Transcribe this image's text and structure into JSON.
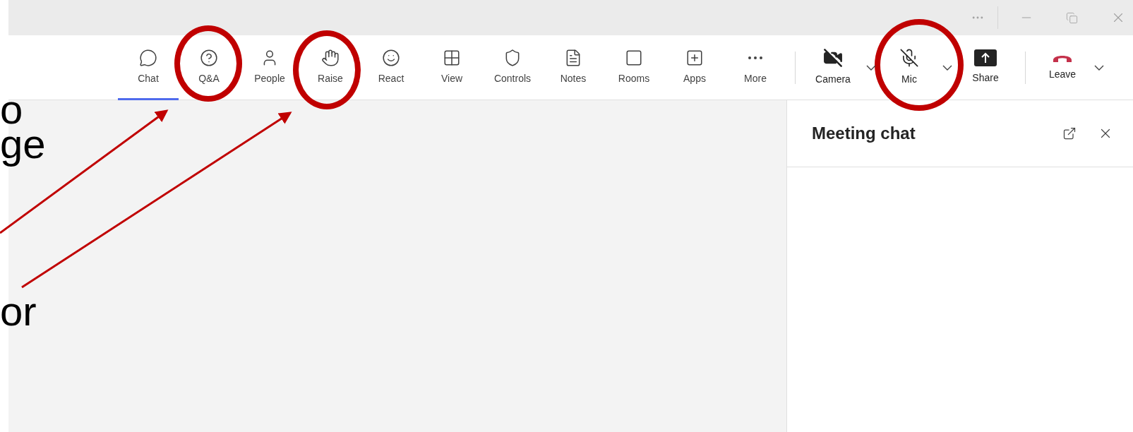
{
  "slide_text": [
    "o",
    "ge",
    "or"
  ],
  "toolbar": {
    "items": [
      {
        "kind": "chat",
        "label": "Chat",
        "selected": true,
        "circled": false
      },
      {
        "kind": "qa",
        "label": "Q&A",
        "selected": false,
        "circled": true
      },
      {
        "kind": "people",
        "label": "People",
        "selected": false,
        "circled": false
      },
      {
        "kind": "raise",
        "label": "Raise",
        "selected": false,
        "circled": true
      },
      {
        "kind": "react",
        "label": "React",
        "selected": false,
        "circled": false
      },
      {
        "kind": "view",
        "label": "View",
        "selected": false,
        "circled": false
      },
      {
        "kind": "controls",
        "label": "Controls",
        "selected": false,
        "circled": false
      },
      {
        "kind": "notes",
        "label": "Notes",
        "selected": false,
        "circled": false
      },
      {
        "kind": "rooms",
        "label": "Rooms",
        "selected": false,
        "circled": false
      },
      {
        "kind": "apps",
        "label": "Apps",
        "selected": false,
        "circled": false
      },
      {
        "kind": "more",
        "label": "More",
        "selected": false,
        "circled": false
      }
    ],
    "devices": [
      {
        "kind": "camera",
        "label": "Camera",
        "on": false,
        "circled": false
      },
      {
        "kind": "mic",
        "label": "Mic",
        "on": false,
        "circled": true
      }
    ],
    "share": {
      "label": "Share"
    },
    "leave": {
      "label": "Leave"
    }
  },
  "chat_panel": {
    "title": "Meeting chat"
  }
}
